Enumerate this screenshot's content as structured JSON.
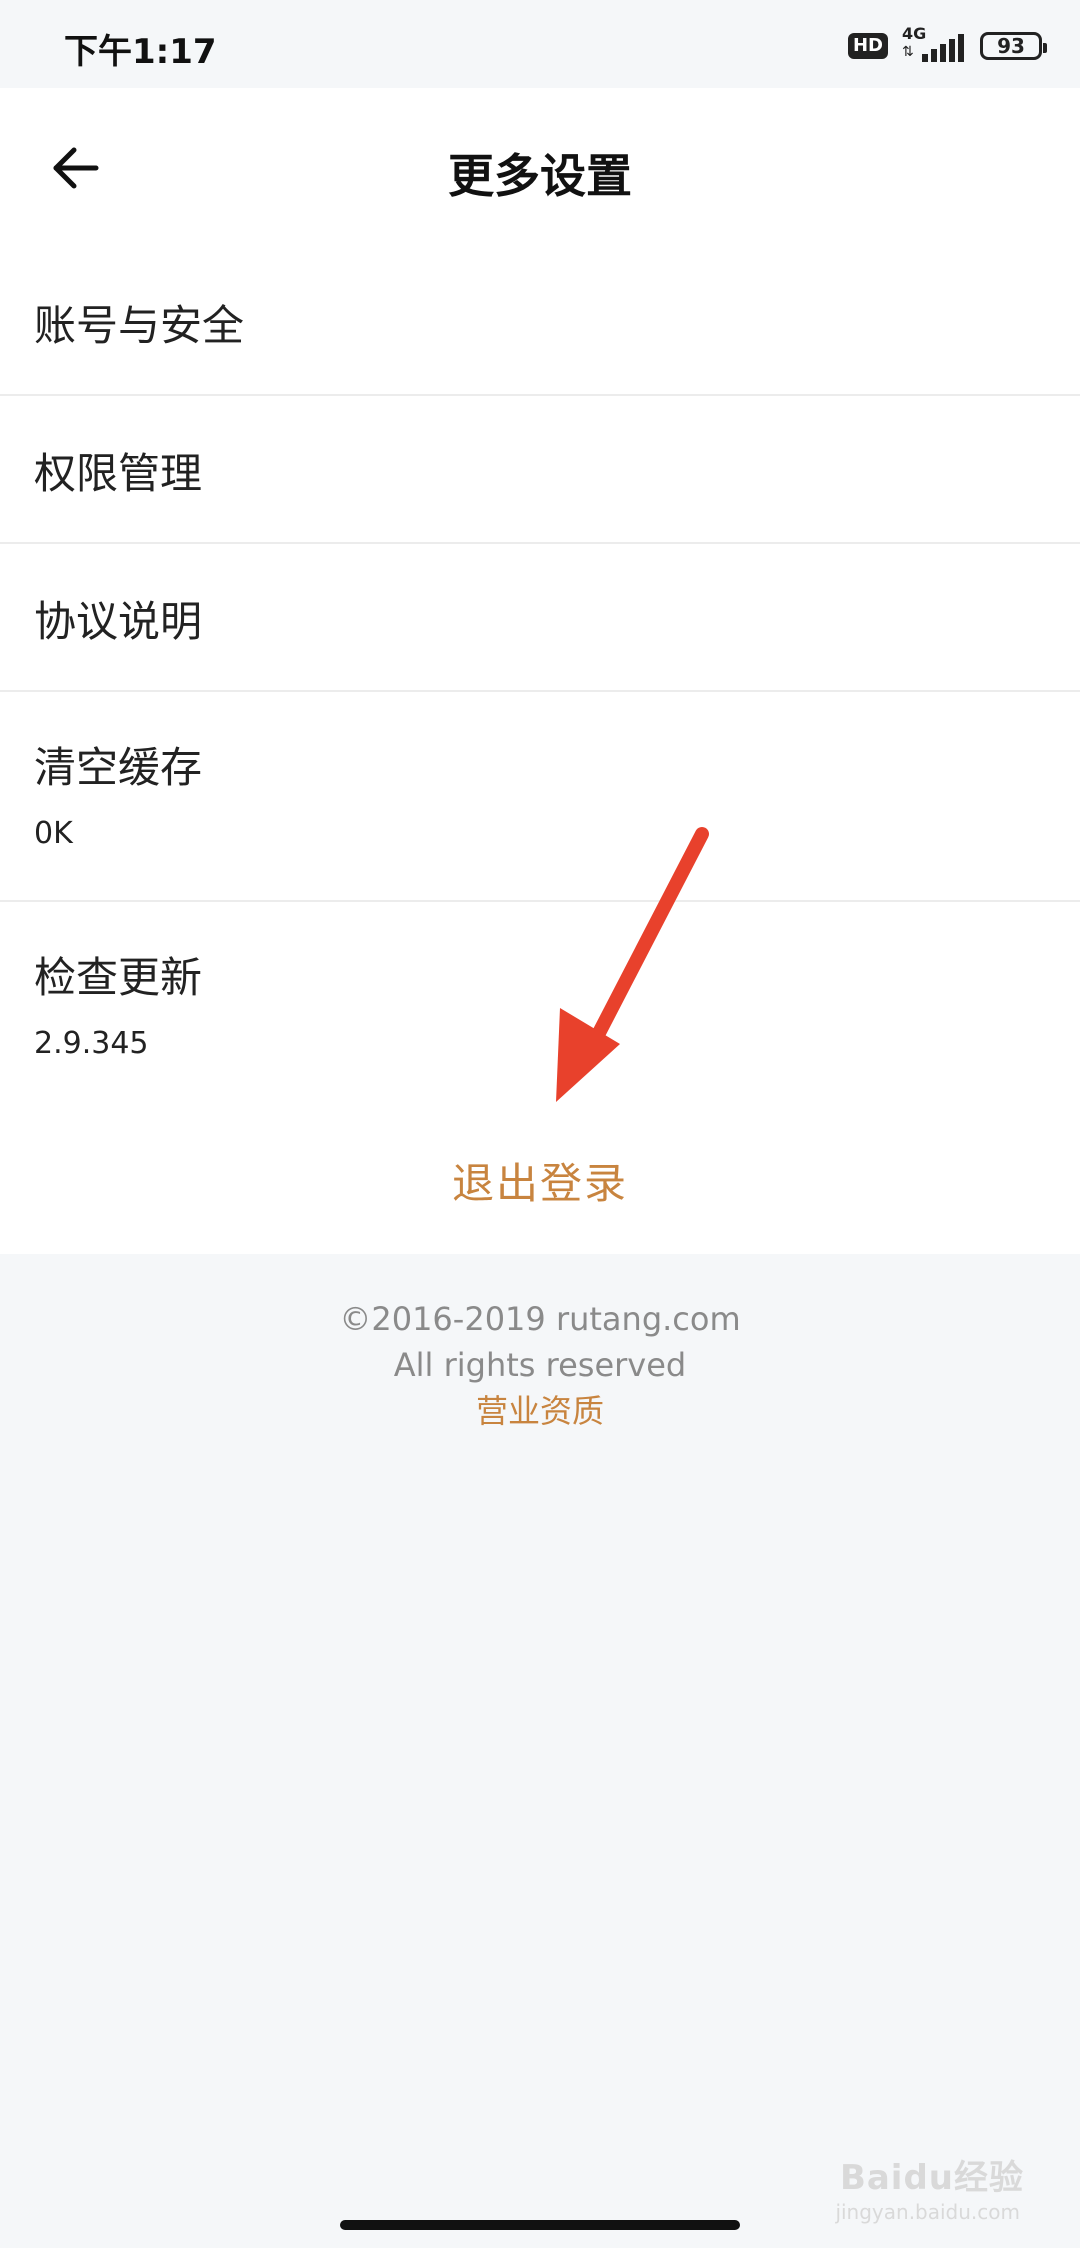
{
  "status_bar": {
    "time": "下午1:17",
    "hd_badge": "HD",
    "network": "4G",
    "battery": "93"
  },
  "header": {
    "title": "更多设置",
    "back_icon": "arrow-left-icon"
  },
  "settings_list": [
    {
      "label": "账号与安全"
    },
    {
      "label": "权限管理"
    },
    {
      "label": "协议说明"
    },
    {
      "label": "清空缓存",
      "sub": "0K"
    },
    {
      "label": "检查更新",
      "sub": "2.9.345"
    }
  ],
  "logout": {
    "label": "退出登录"
  },
  "footer": {
    "copyright": "©2016-2019 rutang.com",
    "rights": "All rights reserved",
    "license_link": "营业资质"
  },
  "watermark": {
    "brand": "Baidu经验",
    "url": "jingyan.baidu.com"
  },
  "colors": {
    "accent": "#c8843f",
    "annotation_arrow": "#e8412c",
    "background": "#f5f7f9"
  }
}
